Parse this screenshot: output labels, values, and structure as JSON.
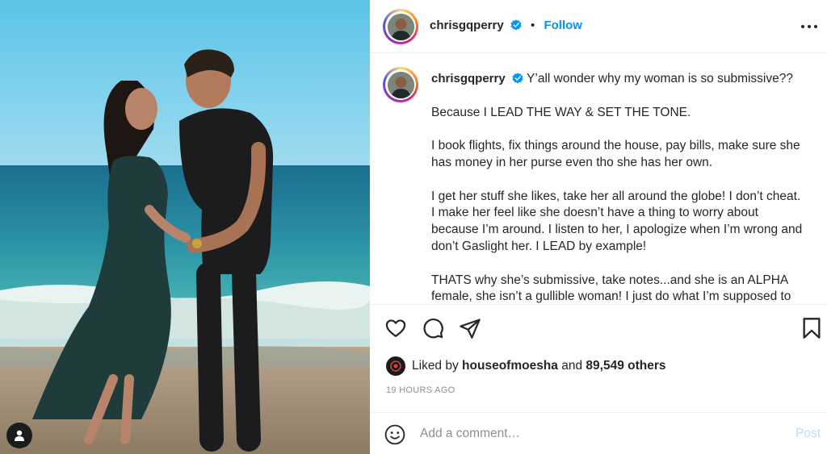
{
  "post": {
    "username": "chrisgqperry",
    "follow_label": "Follow",
    "separator": "•",
    "caption_first": "Y’all wonder why my woman is so submissive??",
    "caption_paragraphs": [
      "Because I LEAD THE WAY & SET THE TONE.",
      "I book flights, fix things around the house, pay bills, make sure she has money in her purse even tho she has her own.",
      "I get her stuff she likes, take her all around the globe! I don’t cheat. I make her feel like she doesn’t have a thing to worry about because I’m around. I listen to her, I apologize when I’m wrong and don’t Gaslight her. I LEAD by example!",
      "THATS why she’s submissive, take notes...and she is an ALPHA female, she isn’t a gullible woman! I just do what I’m supposed to"
    ]
  },
  "likes": {
    "prefix": "Liked by",
    "liker": "houseofmoesha",
    "connector": "and",
    "others": "89,549 others"
  },
  "timestamp": "19 HOURS AGO",
  "comment_box": {
    "placeholder": "Add a comment…",
    "post_label": "Post"
  },
  "icons": [
    "tag-user-icon",
    "more-options-icon",
    "verified-badge-icon",
    "heart-icon",
    "comment-icon",
    "share-icon",
    "bookmark-icon",
    "emoji-icon"
  ],
  "colors": {
    "accent": "#0095f6",
    "verified": "#0095f6",
    "post_disabled": "#b2dffc",
    "muted": "#8e8e8e"
  }
}
